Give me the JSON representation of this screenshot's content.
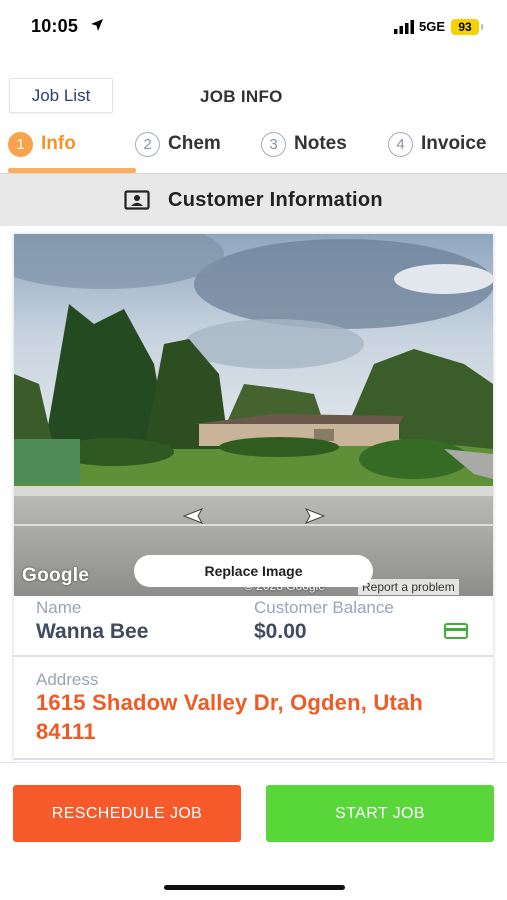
{
  "status_bar": {
    "time": "10:05",
    "network": "5GE",
    "battery": "93"
  },
  "header": {
    "job_list_label": "Job List",
    "title": "JOB INFO"
  },
  "tabs": [
    {
      "num": "1",
      "label": "Info",
      "active": true
    },
    {
      "num": "2",
      "label": "Chem",
      "active": false
    },
    {
      "num": "3",
      "label": "Notes",
      "active": false
    },
    {
      "num": "4",
      "label": "Invoice",
      "active": false
    }
  ],
  "section": {
    "title": "Customer Information",
    "icon": "contact-card-icon"
  },
  "street_view": {
    "provider_logo": "Google",
    "copyright": "© 2023 Google",
    "report_label": "Report a problem",
    "replace_label": "Replace Image"
  },
  "customer": {
    "name_label": "Name",
    "name": "Wanna Bee",
    "balance_label": "Customer Balance",
    "balance": "$0.00",
    "address_label": "Address",
    "address": "1615 Shadow Valley Dr, Ogden, Utah 84111"
  },
  "actions": {
    "reschedule_label": "RESCHEDULE JOB",
    "start_label": "START JOB"
  },
  "colors": {
    "accent_orange": "#f7932c",
    "address_orange": "#f05a24",
    "reschedule": "#f75a2a",
    "start": "#58d63a"
  }
}
